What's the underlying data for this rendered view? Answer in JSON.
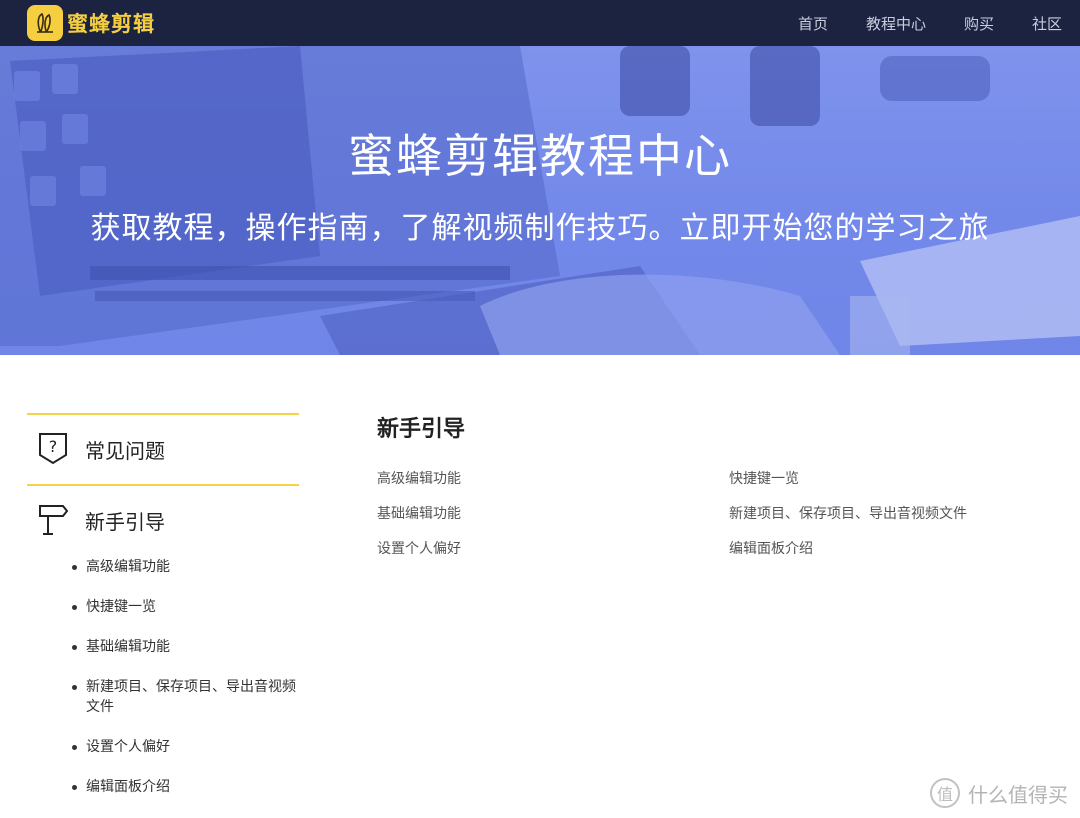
{
  "brand": {
    "name": "蜜蜂剪辑",
    "logo_icon": "bee-icon",
    "accent": "#f5cf3f",
    "nav_bg": "#1c2340"
  },
  "nav": {
    "items": [
      "首页",
      "教程中心",
      "购买",
      "社区"
    ]
  },
  "hero": {
    "title": "蜜蜂剪辑教程中心",
    "subtitle": "获取教程，操作指南，了解视频制作技巧。立即开始您的学习之旅",
    "overlay_color": "#7389ea"
  },
  "sidebar": {
    "categories": [
      {
        "label": "常见问题",
        "icon": "question-shield-icon"
      },
      {
        "label": "新手引导",
        "icon": "signpost-icon"
      }
    ],
    "items": [
      "高级编辑功能",
      "快捷键一览",
      "基础编辑功能",
      "新建项目、保存项目、导出音视频文件",
      "设置个人偏好",
      "编辑面板介绍"
    ],
    "divider_color": "#f3d34a"
  },
  "main": {
    "title": "新手引导",
    "links": [
      "高级编辑功能",
      "快捷键一览",
      "基础编辑功能",
      "新建项目、保存项目、导出音视频文件",
      "设置个人偏好",
      "编辑面板介绍"
    ]
  },
  "watermark": {
    "seal": "值",
    "text": "什么值得买"
  }
}
